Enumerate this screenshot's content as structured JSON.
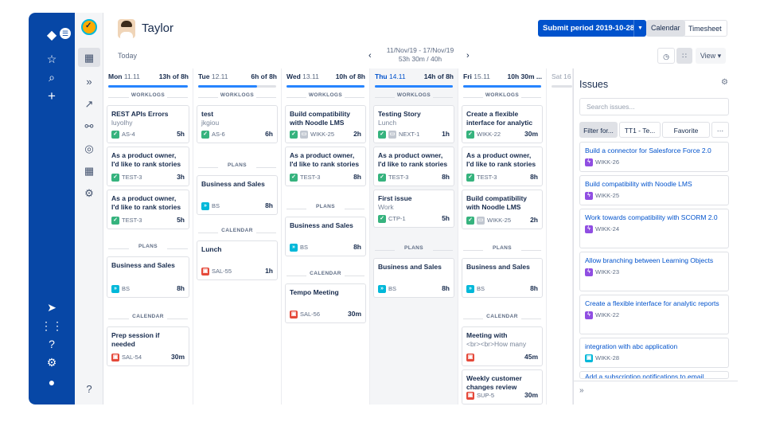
{
  "header": {
    "user_name": "Taylor",
    "submit_label": "Submit period 2019-10-28",
    "view_calendar": "Calendar",
    "view_timesheet": "Timesheet"
  },
  "toolbar": {
    "today": "Today",
    "range_dates": "11/Nov/19 - 17/Nov/19",
    "range_hours": "53h 30m / 40h",
    "view_label": "View ▾"
  },
  "days": [
    {
      "name": "Mon",
      "date": "11.11",
      "hours": "13h of 8h",
      "progress": 1.0
    },
    {
      "name": "Tue",
      "date": "12.11",
      "hours": "6h of 8h",
      "progress": 0.75
    },
    {
      "name": "Wed",
      "date": "13.11",
      "hours": "10h of 8h",
      "progress": 1.0
    },
    {
      "name": "Thu",
      "date": "14.11",
      "hours": "14h of 8h",
      "progress": 1.0
    },
    {
      "name": "Fri",
      "date": "15.11",
      "hours": "10h 30m ...",
      "progress": 1.0
    },
    {
      "name": "Sat",
      "date": "16",
      "hours": "",
      "progress": 0
    }
  ],
  "labels": {
    "worklogs": "WORKLOGS",
    "plans": "PLANS",
    "calendar": "CALENDAR"
  },
  "cards": {
    "mon": [
      {
        "title": "REST APIs Errors",
        "sub": "luyolhy",
        "key": "AS-4",
        "dur": "5h"
      },
      {
        "title": "As a product owner, I'd like to rank stories",
        "key": "TEST-3",
        "dur": "3h"
      },
      {
        "title": "As a product owner, I'd like to rank stories",
        "key": "TEST-3",
        "dur": "5h"
      },
      {
        "title": "Business and Sales",
        "key": "BS",
        "dur": "8h"
      },
      {
        "title": "Prep session if needed",
        "key": "SAL-54",
        "dur": "30m"
      }
    ],
    "tue": [
      {
        "title": "test",
        "sub": "jkgiou",
        "key": "AS-6",
        "dur": "6h"
      },
      {
        "title": "Business and Sales",
        "key": "BS",
        "dur": "8h"
      },
      {
        "title": "Lunch",
        "key": "SAL-55",
        "dur": "1h"
      }
    ],
    "wed": [
      {
        "title": "Build compatibility with Noodle LMS",
        "key": "WIKK-25",
        "dur": "2h"
      },
      {
        "title": "As a product owner, I'd like to rank stories",
        "key": "TEST-3",
        "dur": "8h"
      },
      {
        "title": "Business and Sales",
        "key": "BS",
        "dur": "8h"
      },
      {
        "title": "Tempo Meeting",
        "key": "SAL-56",
        "dur": "30m"
      }
    ],
    "thu": [
      {
        "title": "Testing Story",
        "sub": "Lunch",
        "key": "NEXT-1",
        "dur": "1h"
      },
      {
        "title": "As a product owner, I'd like to rank stories",
        "key": "TEST-3",
        "dur": "8h"
      },
      {
        "title": "First issue",
        "sub": "Work",
        "key": "CTP-1",
        "dur": "5h"
      },
      {
        "title": "Business and Sales",
        "key": "BS",
        "dur": "8h"
      }
    ],
    "fri": [
      {
        "title": "Create a flexible interface for analytic",
        "key": "WIKK-22",
        "dur": "30m"
      },
      {
        "title": "As a product owner, I'd like to rank stories",
        "key": "TEST-3",
        "dur": "8h"
      },
      {
        "title": "Build compatibility with Noodle LMS",
        "key": "WIKK-25",
        "dur": "2h"
      },
      {
        "title": "Business and Sales",
        "key": "BS",
        "dur": "8h"
      },
      {
        "title": "Meeting with",
        "sub": "<br><br>How many",
        "key": "",
        "dur": "45m"
      },
      {
        "title": "Weekly customer changes review",
        "key": "SUP-5",
        "dur": "30m"
      }
    ]
  },
  "issues_panel": {
    "title": "Issues",
    "search_placeholder": "Search issues...",
    "filter_tabs": [
      "Filter for...",
      "TT1 - Te...",
      "Favorite",
      "···"
    ],
    "items": [
      {
        "title": "Build a connector for Salesforce Force 2.0",
        "key": "WIKK-26"
      },
      {
        "title": "Build compatibility with Noodle LMS",
        "key": "WIKK-25"
      },
      {
        "title": "Work towards compatibility with SCORM 2.0",
        "key": "WIKK-24"
      },
      {
        "title": "Allow branching between Learning Objects",
        "key": "WIKK-23"
      },
      {
        "title": "Create a flexible interface for analytic reports",
        "key": "WIKK-22"
      },
      {
        "title": "integration with abc application",
        "key": "WIKK-28"
      },
      {
        "title": "Add a subscription notifications to email",
        "key": ""
      }
    ],
    "expand": "»"
  },
  "colors": {
    "rail": "#0747a6",
    "primary": "#0052cc",
    "progress": "#2684ff"
  }
}
